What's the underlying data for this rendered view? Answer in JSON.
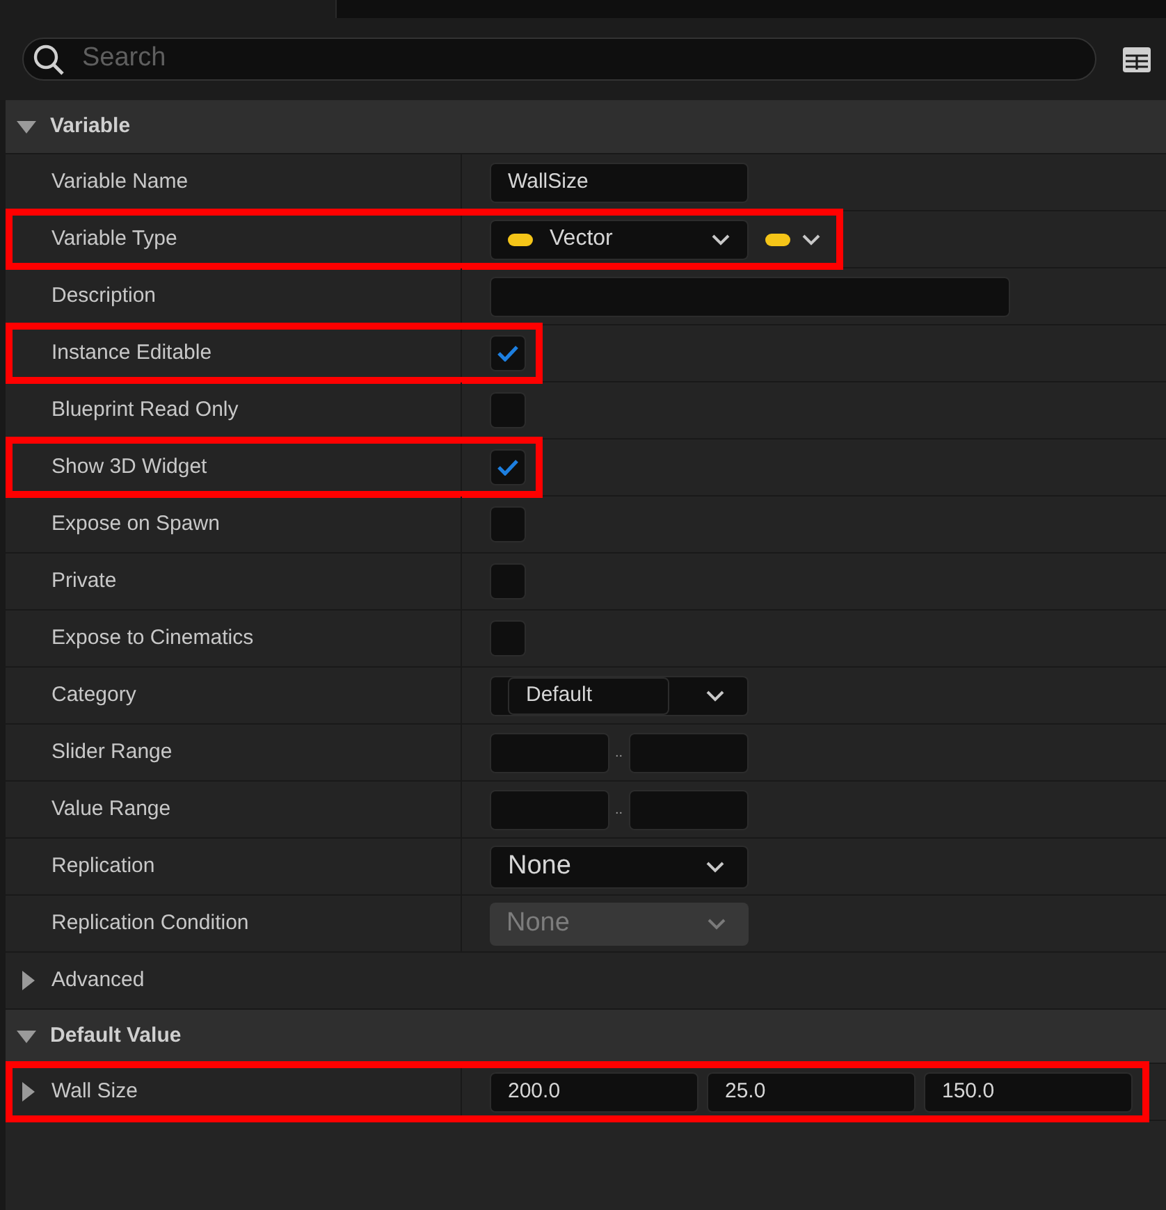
{
  "search": {
    "placeholder": "Search"
  },
  "sections": [
    {
      "title": "Variable",
      "expanded": true,
      "rows": [
        {
          "label": "Variable Name",
          "kind": "text",
          "value": "WallSize",
          "highlighted": false
        },
        {
          "label": "Variable Type",
          "kind": "type",
          "value": "Vector",
          "highlighted": true
        },
        {
          "label": "Description",
          "kind": "wide_text",
          "highlighted": false
        },
        {
          "label": "Instance Editable",
          "kind": "checkbox",
          "checked": true,
          "highlighted": true
        },
        {
          "label": "Blueprint Read Only",
          "kind": "checkbox",
          "checked": false,
          "highlighted": false
        },
        {
          "label": "Show 3D Widget",
          "kind": "checkbox",
          "checked": true,
          "highlighted": true
        },
        {
          "label": "Expose on Spawn",
          "kind": "checkbox",
          "checked": false,
          "highlighted": false
        },
        {
          "label": "Private",
          "kind": "checkbox",
          "checked": false,
          "highlighted": false
        },
        {
          "label": "Expose to Cinematics",
          "kind": "checkbox",
          "checked": false,
          "highlighted": false
        },
        {
          "label": "Category",
          "kind": "combo",
          "value": "Default",
          "highlighted": false
        },
        {
          "label": "Slider Range",
          "kind": "range",
          "separator": "..",
          "highlighted": false
        },
        {
          "label": "Value Range",
          "kind": "range",
          "separator": "..",
          "highlighted": false
        },
        {
          "label": "Replication",
          "kind": "dropdown",
          "value": "None",
          "disabled": false,
          "highlighted": false
        },
        {
          "label": "Replication Condition",
          "kind": "dropdown",
          "value": "None",
          "disabled": true,
          "highlighted": false
        },
        {
          "label": "Advanced",
          "kind": "group",
          "expanded": false,
          "highlighted": false
        }
      ]
    },
    {
      "title": "Default Value",
      "expanded": true,
      "rows": [
        {
          "label": "Wall Size",
          "kind": "vector",
          "expanded": false,
          "values": [
            "200.0",
            "25.0",
            "150.0"
          ],
          "highlighted": true
        }
      ]
    }
  ]
}
